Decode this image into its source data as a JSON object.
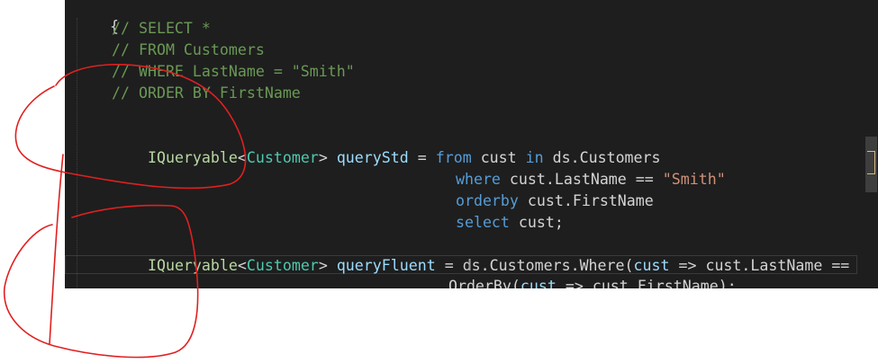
{
  "editor": {
    "brace": "{",
    "comments": [
      "// SELECT *",
      "// FROM Customers",
      "// WHERE LastName = \"Smith\"",
      "// ORDER BY FirstName"
    ],
    "query_std": {
      "iqueryable": "IQueryable",
      "lt": "<",
      "customer_type": "Customer",
      "gt": ">",
      "var_name": "queryStd",
      "assign": " = ",
      "from_kw": "from",
      "cust1": " cust ",
      "in_kw": "in",
      "source": " ds.Customers",
      "where_kw": "where",
      "where_expr": " cust.LastName == ",
      "where_str": "\"Smith\"",
      "orderby_kw": "orderby",
      "orderby_expr": " cust.FirstName",
      "select_kw": "select",
      "select_expr": " cust;"
    },
    "query_fluent": {
      "iqueryable": "IQueryable",
      "lt": "<",
      "customer_type": "Customer",
      "gt": ">",
      "var_name": "queryFluent",
      "line1_rest_a": " = ds.Customers.Where(",
      "lambda1_param": "cust",
      "line1_rest_b": " => ",
      "lambda1_body": "cust.LastName ==",
      "line2_a": ".OrderBy(",
      "lambda2_param": "cust",
      "line2_b": " => ",
      "lambda2_body": "cust.FirstName",
      "line2_c": ");"
    }
  },
  "colors": {
    "editor_bg": "#1e1e1e",
    "comment": "#6a9955",
    "keyword": "#569cd6",
    "type": "#4ec9b0",
    "string": "#ce9178",
    "annotation": "#e02020"
  }
}
